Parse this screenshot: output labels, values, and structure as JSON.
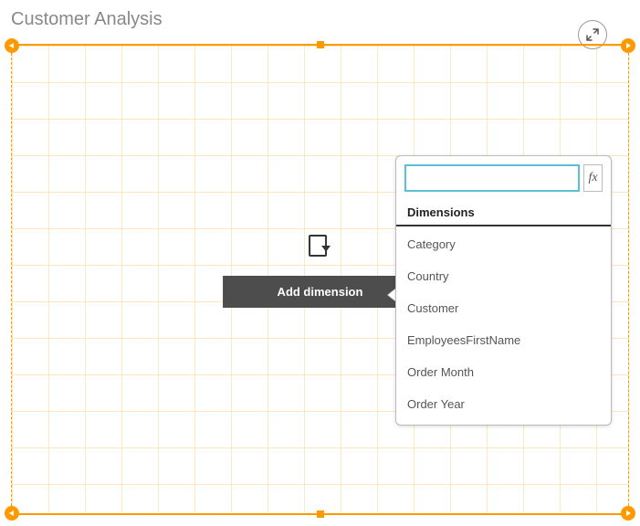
{
  "title": "Customer Analysis",
  "placeholder": {
    "add_dimension_label": "Add dimension"
  },
  "popup": {
    "search_placeholder": "",
    "fx_label": "fx",
    "section_header": "Dimensions",
    "items": [
      "Category",
      "Country",
      "Customer",
      "EmployeesFirstName",
      "Order Month",
      "Order Year"
    ]
  }
}
